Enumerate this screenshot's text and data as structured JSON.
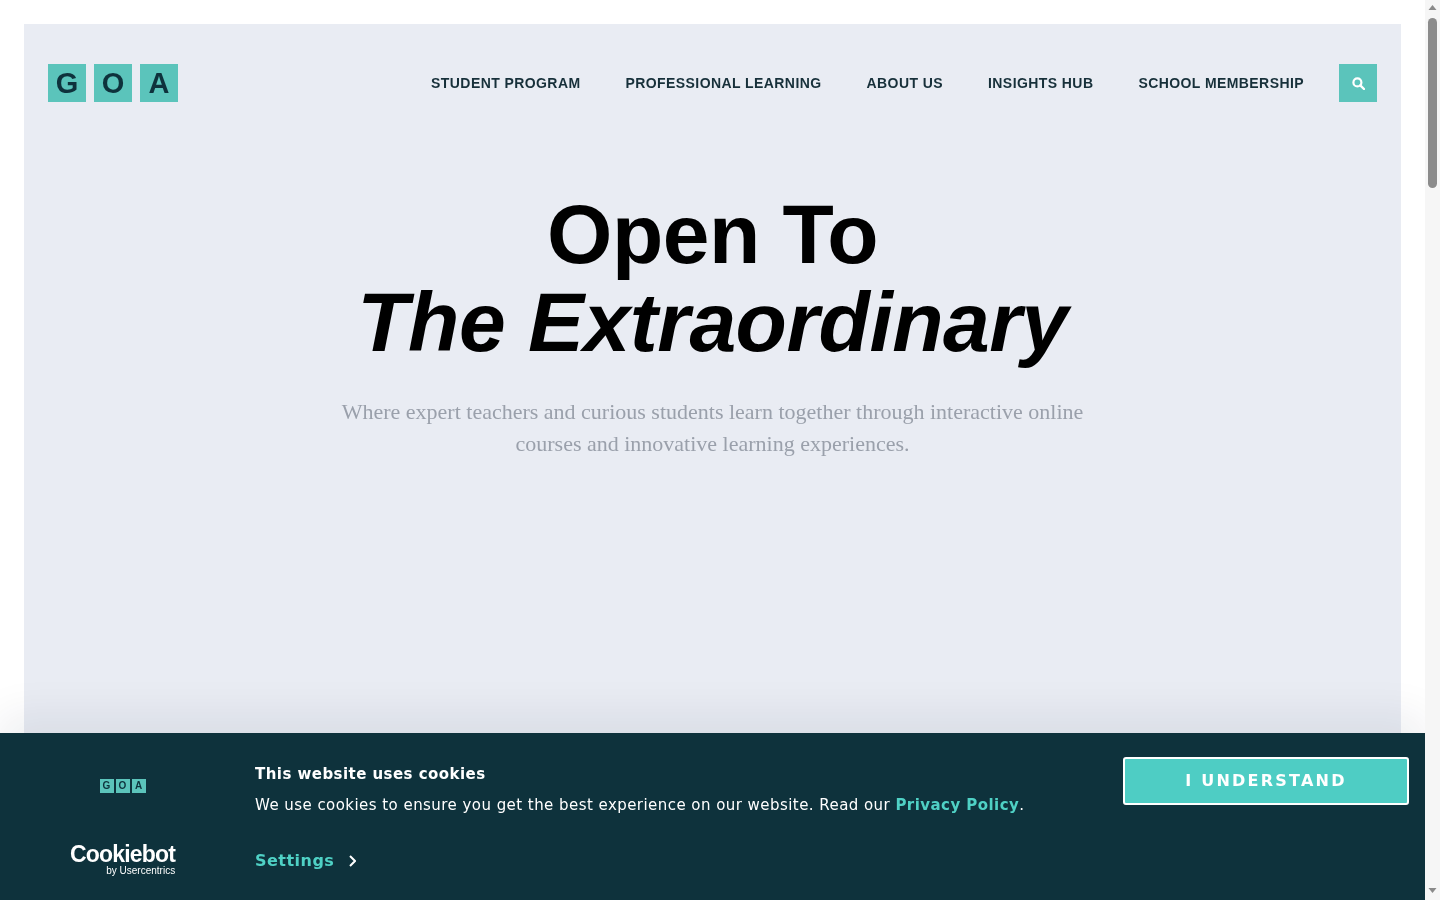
{
  "header": {
    "logo": [
      "G",
      "O",
      "A"
    ],
    "nav": [
      "STUDENT PROGRAM",
      "PROFESSIONAL LEARNING",
      "ABOUT US",
      "INSIGHTS HUB",
      "SCHOOL MEMBERSHIP"
    ]
  },
  "hero": {
    "title": "Open To",
    "title_italic": "The Extraordinary",
    "subtitle": "Where expert teachers and curious students learn together through interactive online courses and innovative learning experiences."
  },
  "cookie_banner": {
    "logo": [
      "G",
      "O",
      "A"
    ],
    "brand": "Cookiebot",
    "brand_tagline": "by Usercentrics",
    "heading": "This website uses cookies",
    "message": {
      "text": "We use cookies to ensure you get the best experience on our website. Read our ",
      "link": "Privacy Policy",
      "text_end": "."
    },
    "settings": "Settings",
    "button": "I UNDERSTAND"
  }
}
